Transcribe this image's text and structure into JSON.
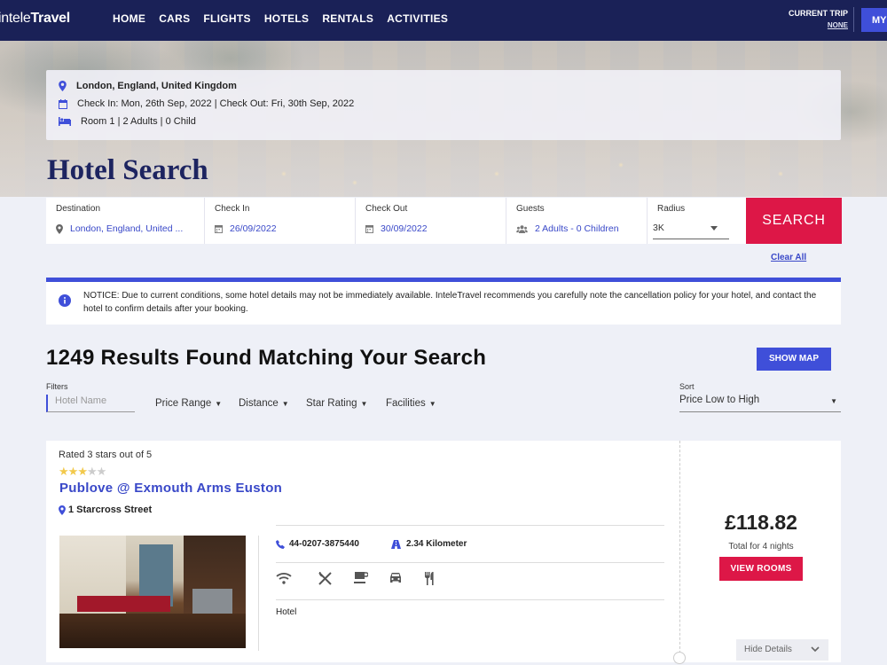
{
  "nav": {
    "logo_prefix": "intele",
    "logo_suffix": "Travel",
    "links": [
      "HOME",
      "CARS",
      "FLIGHTS",
      "HOTELS",
      "RENTALS",
      "ACTIVITIES"
    ],
    "trip_label": "CURRENT TRIP",
    "trip_value": "NONE",
    "my_button": "MY"
  },
  "summary": {
    "location": "London, England, United Kingdom",
    "dates": "Check In: Mon, 26th Sep, 2022 | Check Out: Fri, 30th Sep, 2022",
    "rooms": "Room 1 | 2 Adults | 0 Child"
  },
  "page_title": "Hotel Search",
  "search": {
    "destination_label": "Destination",
    "destination_value": "London, England, United ...",
    "checkin_label": "Check In",
    "checkin_value": "26/09/2022",
    "checkout_label": "Check Out",
    "checkout_value": "30/09/2022",
    "guests_label": "Guests",
    "guests_value": "2 Adults - 0 Children",
    "radius_label": "Radius",
    "radius_value": "3K",
    "search_button": "SEARCH",
    "clear_all": "Clear All"
  },
  "notice": "NOTICE: Due to current conditions, some hotel details may not be immediately available. InteleTravel recommends you carefully note the cancellation policy for your hotel, and contact the hotel to confirm details after your booking.",
  "results": {
    "heading": "1249 Results Found Matching Your Search",
    "show_map": "SHOW MAP"
  },
  "filters": {
    "label": "Filters",
    "hotel_name_placeholder": "Hotel Name",
    "price_range": "Price Range",
    "distance": "Distance",
    "star_rating": "Star Rating",
    "facilities": "Facilities",
    "sort_label": "Sort",
    "sort_value": "Price Low to High"
  },
  "hotel": {
    "rated_text": "Rated 3 stars out of 5",
    "stars": 3,
    "stars_max": 5,
    "name": "Publove @ Exmouth Arms Euston",
    "address": "1 Starcross Street",
    "phone": "44-0207-3875440",
    "distance": "2.34 Kilometer",
    "facility_icons": [
      "wifi-icon",
      "restaurant-icon",
      "coffee-icon",
      "parking-icon",
      "dining-icon"
    ],
    "type": "Hotel",
    "price": "£118.82",
    "price_note": "Total for 4 nights",
    "view_rooms": "VIEW ROOMS",
    "hide_details": "Hide Details"
  },
  "colors": {
    "nav_bg": "#1a2157",
    "accent_blue": "#3f4fd9",
    "link_blue": "#3948c8",
    "search_red": "#dd1747",
    "title_navy": "#1d2460",
    "star_gold": "#f2c94c"
  }
}
